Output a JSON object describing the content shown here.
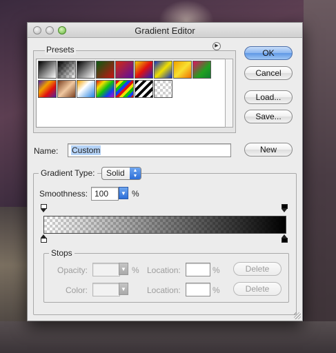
{
  "window": {
    "title": "Gradient Editor"
  },
  "presets": {
    "label": "Presets",
    "menu_icon": "flyout-menu-icon"
  },
  "buttons": {
    "ok": "OK",
    "cancel": "Cancel",
    "load": "Load...",
    "save": "Save...",
    "new": "New"
  },
  "name": {
    "label": "Name:",
    "value": "Custom"
  },
  "gradient_type": {
    "label": "Gradient Type:",
    "value": "Solid"
  },
  "smoothness": {
    "label": "Smoothness:",
    "value": "100",
    "unit": "%"
  },
  "stops": {
    "label": "Stops",
    "opacity_label": "Opacity:",
    "opacity_value": "",
    "opacity_unit": "%",
    "location_label": "Location:",
    "location_value_1": "",
    "location_unit_1": "%",
    "delete_label": "Delete",
    "color_label": "Color:",
    "location_value_2": "",
    "location_unit_2": "%"
  },
  "colors": {
    "accent": "#5f97e5",
    "stop_start": "#ffffff",
    "stop_end": "#000000"
  }
}
